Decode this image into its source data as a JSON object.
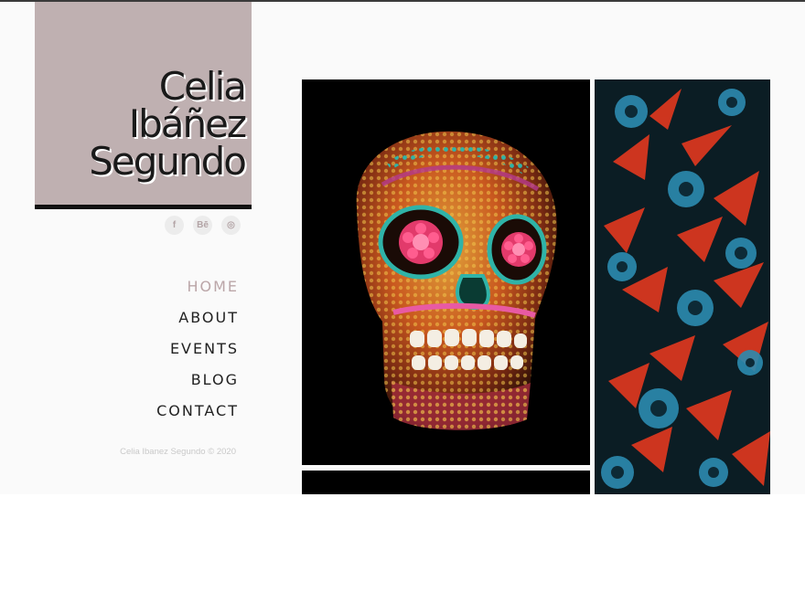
{
  "site": {
    "logo_lines": [
      "Celia",
      "Ibáñez",
      "Segundo"
    ],
    "social": [
      {
        "icon": "facebook-icon",
        "glyph": "f"
      },
      {
        "icon": "behance-icon",
        "glyph": "Bē"
      },
      {
        "icon": "instagram-icon",
        "glyph": "◎"
      }
    ],
    "nav": [
      {
        "label": "HOME",
        "active": true
      },
      {
        "label": "ABOUT",
        "active": false
      },
      {
        "label": "EVENTS",
        "active": false
      },
      {
        "label": "BLOG",
        "active": false
      },
      {
        "label": "CONTACT",
        "active": false
      }
    ],
    "footer": "Celia Ibanez Segundo © 2020"
  },
  "gallery": {
    "images": [
      {
        "name": "sugar-skull-image"
      },
      {
        "name": "succulents-image"
      },
      {
        "name": "dark-image"
      }
    ]
  },
  "colors": {
    "logo_bg": "#bfb0b1",
    "nav_active": "#bba6a8",
    "nav_default": "#222222"
  }
}
